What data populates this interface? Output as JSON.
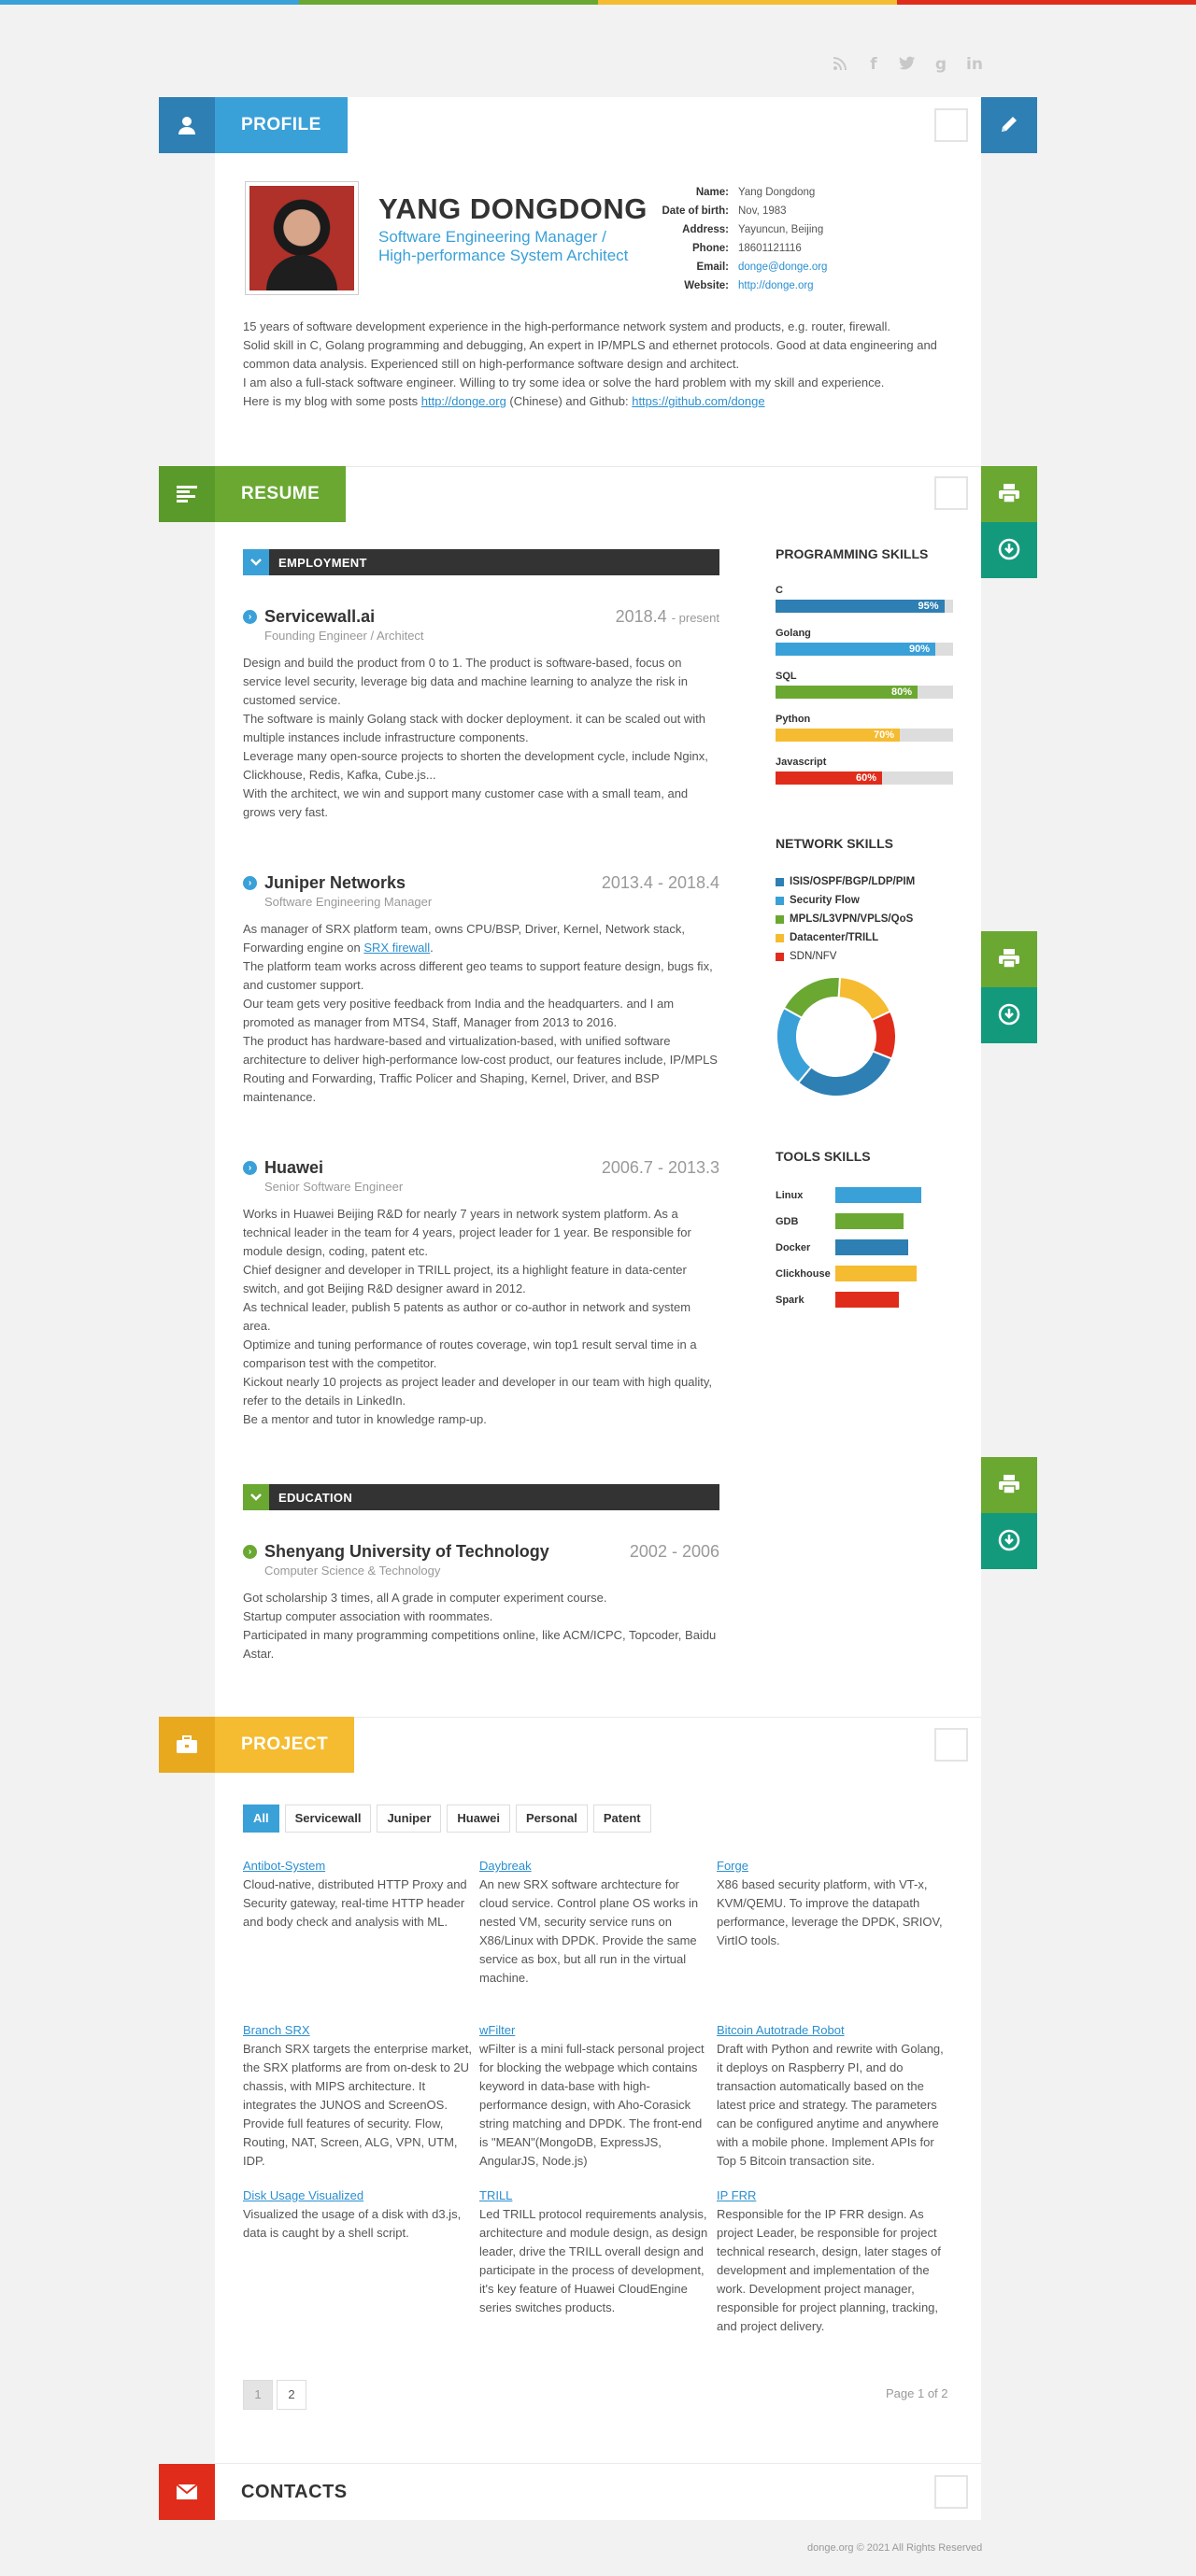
{
  "colors": {
    "blue": "#3aa0d8",
    "darkblue": "#2e7fb3",
    "green": "#6aa832",
    "teal": "#139a7c",
    "yellow": "#f5bb31",
    "red": "#e02d1b",
    "dark": "#333333"
  },
  "social": [
    "rss-icon",
    "facebook-icon",
    "twitter-icon",
    "googleplus-icon",
    "linkedin-icon"
  ],
  "profile": {
    "section_label": "PROFILE",
    "name": "YANG DONGDONG",
    "title": "Software Engineering Manager / High-performance System Architect",
    "info": [
      {
        "k": "Name:",
        "v": "Yang Dongdong"
      },
      {
        "k": "Date of birth:",
        "v": "Nov, 1983"
      },
      {
        "k": "Address:",
        "v": "Yayuncun, Beijing"
      },
      {
        "k": "Phone:",
        "v": "18601121116"
      },
      {
        "k": "Email:",
        "v": "donge@donge.org"
      },
      {
        "k": "Website:",
        "v": "http://donge.org"
      }
    ],
    "summary": [
      "15 years of software development experience in the high-performance network system and products, e.g. router, firewall.",
      "Solid skill in C, Golang programming and debugging, An expert in IP/MPLS and ethernet protocols. Good at data engineering and common data analysis. Experienced still on high-performance software design and architect.",
      "I am also a full-stack software engineer. Willing to try some idea or solve the hard problem with my skill and experience."
    ],
    "blog_prefix": "Here is my blog with some posts ",
    "blog_link": "http://donge.org",
    "blog_mid": " (Chinese) and Github: ",
    "github_link": "https://github.com/donge"
  },
  "resume": {
    "section_label": "RESUME",
    "employment_label": "EMPLOYMENT",
    "education_label": "EDUCATION",
    "jobs": [
      {
        "company": "Servicewall.ai",
        "period": "2018.4",
        "period_suffix": "- present",
        "role": "Founding Engineer / Architect",
        "desc": [
          "Design and build the product from 0 to 1. The product is software-based, focus on service level security, leverage big data and machine learning to analyze the risk in customed service.",
          "The software is mainly Golang stack with docker deployment. it can be scaled out with multiple instances include infrastructure components.",
          "Leverage many open-source projects to shorten the development cycle, include Nginx, Clickhouse, Redis, Kafka, Cube.js...",
          "With the architect, we win and support many customer case with a small team, and grows very fast."
        ]
      },
      {
        "company": "Juniper Networks",
        "period": "2013.4 - 2018.4",
        "role": "Software Engineering Manager",
        "desc_intro": "As manager of SRX platform team, owns CPU/BSP, Driver, Kernel, Network stack, Forwarding engine on ",
        "desc_link": "SRX firewall",
        "desc_after": ".",
        "desc": [
          "The platform team works across different geo teams to support feature design, bugs fix, and customer support.",
          "Our team gets very positive feedback from India and the headquarters. and I am promoted as manager from MTS4, Staff, Manager from 2013 to 2016.",
          "The product has hardware-based and virtualization-based, with unified software architecture to deliver high-performance low-cost product, our features include, IP/MPLS Routing and Forwarding, Traffic Policer and Shaping, Kernel, Driver, and BSP maintenance."
        ]
      },
      {
        "company": "Huawei",
        "period": "2006.7 - 2013.3",
        "role": "Senior Software Engineer",
        "desc": [
          "Works in Huawei Beijing R&D for nearly 7 years in network system platform. As a technical leader in the team for 4 years, project leader for 1 year. Be responsible for module design, coding, patent etc.",
          "Chief designer and developer in TRILL project, its a highlight feature in data-center switch, and got Beijing R&D designer award in 2012.",
          "As technical leader, publish 5 patents as author or co-author in network and system area.",
          "Optimize and tuning performance of routes coverage, win top1 result serval time in a comparison test with the competitor.",
          "Kickout nearly 10 projects as project leader and developer in our team with high quality, refer to the details in LinkedIn.",
          "Be a mentor and tutor in knowledge ramp-up."
        ]
      }
    ],
    "education": {
      "school": "Shenyang University of Technology",
      "period": "2002 - 2006",
      "major": "Computer Science & Technology",
      "desc": [
        "Got scholarship 3 times, all A grade in computer experiment course.",
        "Startup computer association with roommates.",
        "Participated in many programming competitions online, like ACM/ICPC, Topcoder, Baidu Astar."
      ]
    },
    "programming_skills_label": "PROGRAMMING SKILLS",
    "programming_skills": [
      {
        "name": "C",
        "pct": 95,
        "label": "95%",
        "color": "#2e7fb3"
      },
      {
        "name": "Golang",
        "pct": 90,
        "label": "90%",
        "color": "#3aa0d8"
      },
      {
        "name": "SQL",
        "pct": 80,
        "label": "80%",
        "color": "#6aa832"
      },
      {
        "name": "Python",
        "pct": 70,
        "label": "70%",
        "color": "#f5bb31"
      },
      {
        "name": "Javascript",
        "pct": 60,
        "label": "60%",
        "color": "#e02d1b"
      }
    ],
    "network_skills_label": "NETWORK SKILLS",
    "network_skills": [
      {
        "name": "ISIS/OSPF/BGP/LDP/PIM",
        "share": 30,
        "color": "#2e7fb3",
        "bold": true
      },
      {
        "name": "Security Flow",
        "share": 22,
        "color": "#3aa0d8",
        "bold": true
      },
      {
        "name": "MPLS/L3VPN/VPLS/QoS",
        "share": 18,
        "color": "#6aa832",
        "bold": true
      },
      {
        "name": "Datacenter/TRILL",
        "share": 17,
        "color": "#f5bb31",
        "bold": true
      },
      {
        "name": "SDN/NFV",
        "share": 13,
        "color": "#e02d1b",
        "bold": false
      }
    ],
    "tools_skills_label": "TOOLS SKILLS",
    "tools_skills": [
      {
        "name": "Linux",
        "level": 0.71,
        "color": "#3aa0d8"
      },
      {
        "name": "GDB",
        "level": 0.56,
        "color": "#6aa832"
      },
      {
        "name": "Docker",
        "level": 0.6,
        "color": "#2e7fb3"
      },
      {
        "name": "Clickhouse",
        "level": 0.67,
        "color": "#f5bb31"
      },
      {
        "name": "Spark",
        "level": 0.52,
        "color": "#e02d1b"
      }
    ]
  },
  "project": {
    "section_label": "PROJECT",
    "filters": [
      "All",
      "Servicewall",
      "Juniper",
      "Huawei",
      "Personal",
      "Patent"
    ],
    "items": [
      {
        "title": "Antibot-System",
        "desc": "Cloud-native, distributed HTTP Proxy and Security gateway, real-time HTTP header and body check and analysis with ML."
      },
      {
        "title": "Daybreak",
        "desc": "An new SRX software archtecture for cloud service. Control plane OS works in nested VM, security service runs on X86/Linux with DPDK. Provide the same service as box, but all run in the virtual machine."
      },
      {
        "title": "Forge",
        "desc": "X86 based security platform, with VT-x, KVM/QEMU. To improve the datapath performance, leverage the DPDK, SRIOV, VirtIO tools."
      },
      {
        "title": "Branch SRX",
        "desc": "Branch SRX targets the enterprise market, the SRX platforms are from on-desk to 2U chassis, with MIPS architecture. It integrates the JUNOS and ScreenOS. Provide full features of security. Flow, Routing, NAT, Screen, ALG, VPN, UTM, IDP."
      },
      {
        "title": "wFilter",
        "desc": "wFilter is a mini full-stack personal project for blocking the webpage which contains keyword in data-base with high-performance design, with Aho-Corasick string matching and DPDK. The front-end is \"MEAN\"(MongoDB, ExpressJS, AngularJS, Node.js)"
      },
      {
        "title": "Bitcoin Autotrade Robot",
        "desc": "Draft with Python and rewrite with Golang, it deploys on Raspberry PI, and do transaction automatically based on the latest price and strategy. The parameters can be configured anytime and anywhere with a mobile phone. Implement APIs for Top 5 Bitcoin transaction site."
      },
      {
        "title": "Disk Usage Visualized",
        "desc": "Visualized the usage of a disk with d3.js, data is caught by a shell script."
      },
      {
        "title": "TRILL",
        "desc": "Led TRILL protocol requirements analysis, architecture and module design, as design leader, drive the TRILL overall design and participate in the process of development, it's key feature of Huawei CloudEngine series switches products."
      },
      {
        "title": "IP FRR",
        "desc": "Responsible for the IP FRR design. As project Leader, be responsible for project technical research, design, later stages of development and implementation of the work. Development project manager, responsible for project planning, tracking, and project delivery."
      }
    ],
    "pages": [
      "1",
      "2"
    ],
    "page_of": "Page 1 of 2"
  },
  "contacts": {
    "section_label": "CONTACTS"
  },
  "footer": "donge.org © 2021 All Rights Reserved"
}
